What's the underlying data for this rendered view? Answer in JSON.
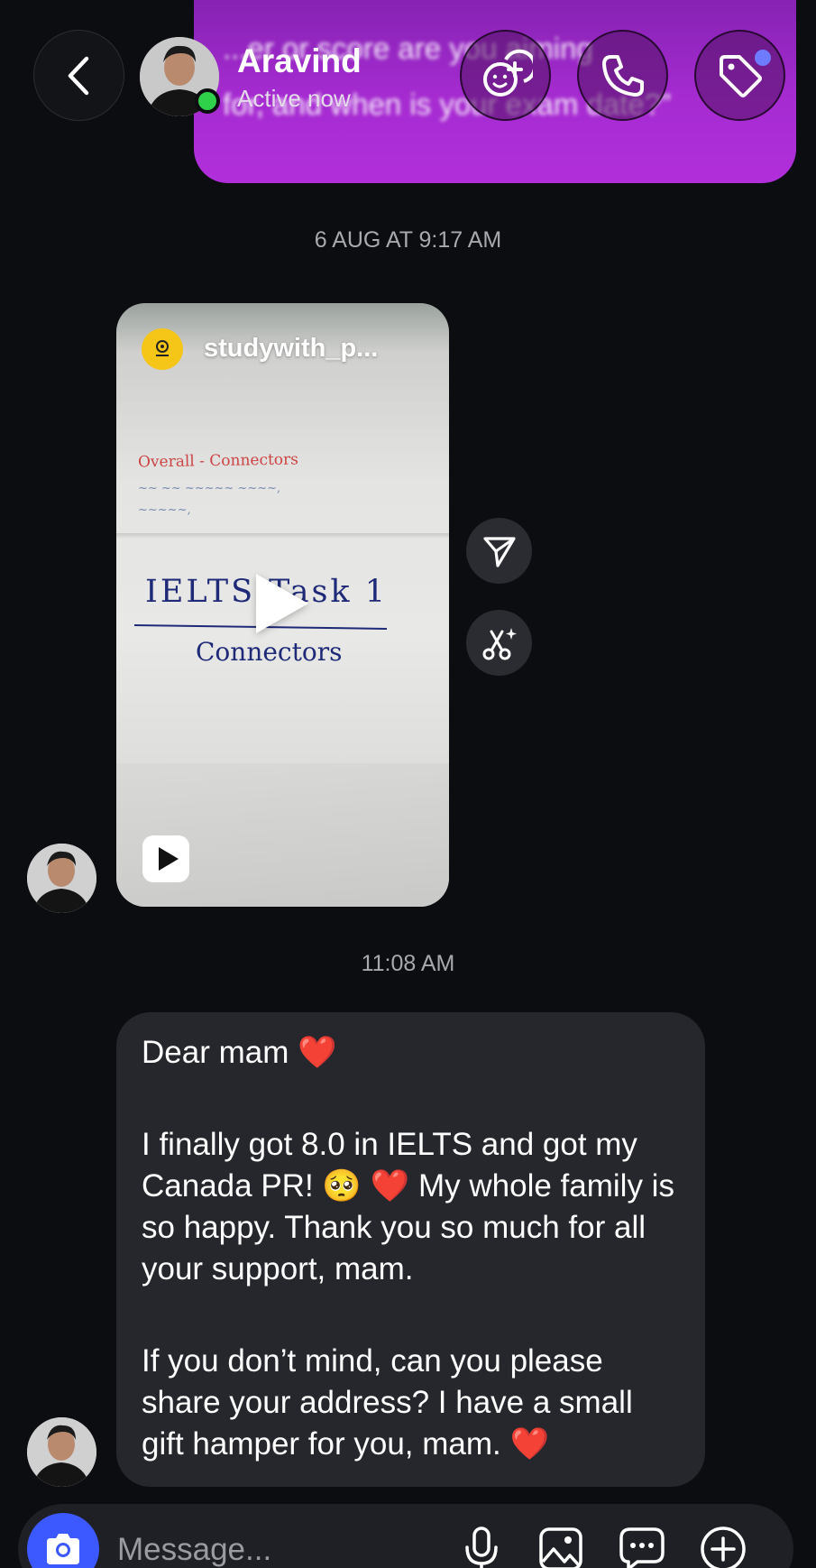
{
  "sent_bubble": {
    "line1": "...er or score are you aiming",
    "line2": "for, and when is your exam date?”"
  },
  "header": {
    "name": "Aravind",
    "status": "Active now"
  },
  "messages": {
    "timestamp_1": "6 AUG AT 9:17 AM",
    "reel": {
      "account": "studywith_p...",
      "title_text": "IELTS-Task 1",
      "subtitle_text": "Connectors",
      "small_heading": "Overall - Connectors"
    },
    "timestamp_2": "11:08 AM",
    "text_message": {
      "line1": "Dear mam ❤️",
      "paragraph2": "I finally got 8.0 in IELTS and got my Canada PR! 🥺 ❤️ My whole family is so happy. Thank you so much for all your support, mam.",
      "paragraph3": "If you don’t mind, can you please share your address? I have a small gift hamper for you, mam. ❤️"
    }
  },
  "composer": {
    "placeholder": "Message..."
  },
  "icons": {
    "back": "chevron-left-icon",
    "effects": "sticker-plus-icon",
    "call": "phone-icon",
    "tag": "tag-icon",
    "share": "send-icon",
    "remix": "scissors-sparkle-icon",
    "camera": "camera-icon",
    "mic": "microphone-icon",
    "gallery": "image-icon",
    "sticker": "chat-bubble-icon",
    "add": "plus-circle-icon"
  },
  "colors": {
    "background": "#0c0d11",
    "sent_bubble": "#a52bd0",
    "received_bubble": "#26272c",
    "online": "#2fd14b",
    "camera_button": "#3c59ff",
    "badge": "#6f7bff"
  }
}
